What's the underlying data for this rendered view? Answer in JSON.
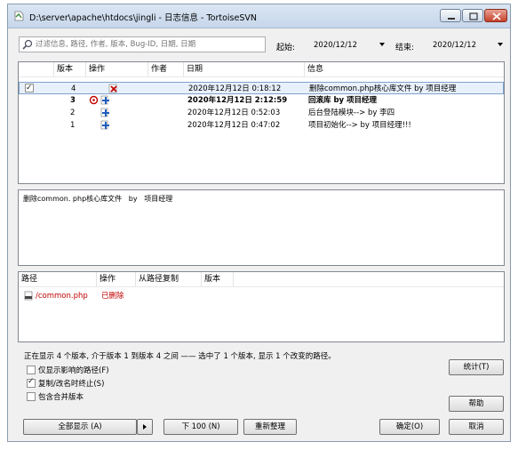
{
  "window": {
    "title": "D:\\server\\apache\\htdocs\\jingli - 日志信息 - TortoiseSVN"
  },
  "filter": {
    "search_placeholder": "过滤信息, 路径, 作者, 版本, Bug-ID, 日期, 日期",
    "from_label": "起始:",
    "from_date": "2020/12/12",
    "to_label": "结束:",
    "to_date": "2020/12/12"
  },
  "log_table": {
    "columns": [
      "版本",
      "操作",
      "作者",
      "日期",
      "信息"
    ],
    "rows": [
      {
        "revision": "4",
        "date": "2020年12月12日 0:18:12",
        "message": "删除common.php核心库文件 by 项目经理",
        "selected": true,
        "checked": true,
        "bold": false,
        "ops": [
          "delete"
        ]
      },
      {
        "revision": "3",
        "date": "2020年12月12日 2:12:59",
        "message": "回滚库 by 项目经理",
        "selected": false,
        "checked": false,
        "bold": true,
        "ops": [
          "modify",
          "add"
        ]
      },
      {
        "revision": "2",
        "date": "2020年12月12日 0:52:03",
        "message": "后台登陆模块--> by 李四",
        "selected": false,
        "checked": false,
        "bold": false,
        "ops": [
          "add"
        ]
      },
      {
        "revision": "1",
        "date": "2020年12月12日 0:47:02",
        "message": "项目初始化--> by 项目经理!!!",
        "selected": false,
        "checked": false,
        "bold": false,
        "ops": [
          "add"
        ]
      }
    ]
  },
  "message_text": "删除common. php核心库文件   by   项目经理",
  "paths_table": {
    "columns": [
      "路径",
      "操作",
      "从路径复制",
      "版本"
    ],
    "rows": [
      {
        "path": "/common.php",
        "action": "已删除"
      }
    ]
  },
  "status_text": "正在显示 4 个版本, 介于版本 1 到版本 4 之间 —— 选中了 1 个版本, 显示 1 个改变的路径。",
  "options": [
    {
      "label": "仅显示影响的路径(F)",
      "checked": false
    },
    {
      "label": "复制/改名时终止(S)",
      "checked": true
    },
    {
      "label": "包含合并版本",
      "checked": false
    }
  ],
  "buttons": {
    "stats": "统计(T)",
    "help": "帮助",
    "show_all": "全部显示 (A)",
    "next_100": "下 100 (N)",
    "refresh": "重新整理",
    "ok": "确定(O)",
    "cancel": "取消"
  },
  "colors": {
    "deleted": "#c00000",
    "add_icon": "#1f5fbf",
    "titlebar": "#c6d6ea",
    "selection": "#e8f0fb"
  },
  "icons": {
    "app": "tortoisesvn-icon",
    "search": "search-icon",
    "delete": "delete-icon",
    "add": "add-icon",
    "modify": "modify-icon",
    "file": "php-file-icon"
  }
}
